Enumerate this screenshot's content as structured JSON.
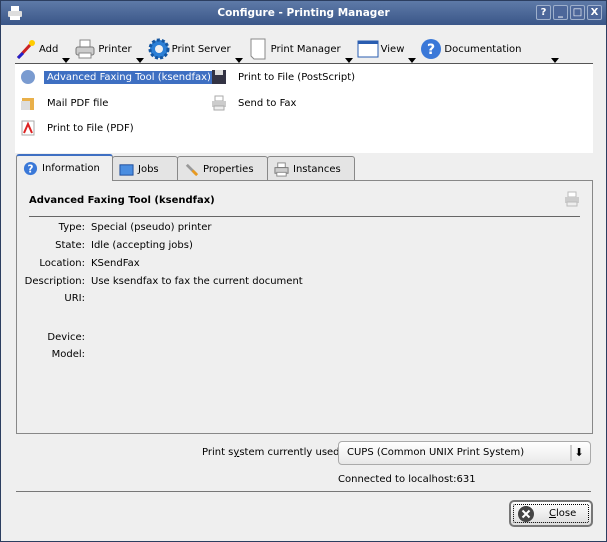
{
  "window": {
    "title": "Configure - Printing Manager",
    "buttons": [
      "?",
      "_",
      "□",
      "X"
    ]
  },
  "toolbar": [
    {
      "label": "Add",
      "icon": "wand-icon"
    },
    {
      "label": "Printer",
      "icon": "printer-icon"
    },
    {
      "label": "Print Server",
      "icon": "gear-icon"
    },
    {
      "label": "Print Manager",
      "icon": "document-icon"
    },
    {
      "label": "View",
      "icon": "window-icon"
    },
    {
      "label": "Documentation",
      "icon": "help-icon"
    }
  ],
  "printers": [
    {
      "label": "Advanced Faxing Tool (ksendfax)",
      "selected": true
    },
    {
      "label": "Print to File (PostScript)"
    },
    {
      "label": "Mail PDF file"
    },
    {
      "label": "Send to Fax"
    },
    {
      "label": "Print to File (PDF)"
    }
  ],
  "tabs": [
    {
      "label": "Information"
    },
    {
      "label": "Jobs"
    },
    {
      "label": "Properties"
    },
    {
      "label": "Instances"
    }
  ],
  "info": {
    "title": "Advanced Faxing Tool (ksendfax)",
    "rows": [
      {
        "key": "Type:",
        "value": "Special (pseudo) printer"
      },
      {
        "key": "State:",
        "value": "Idle (accepting jobs)"
      },
      {
        "key": "Location:",
        "value": "KSendFax"
      },
      {
        "key": "Description:",
        "value": "Use ksendfax to fax the current document"
      },
      {
        "key": "URI:",
        "value": ""
      },
      {
        "key": "Device:",
        "value": ""
      },
      {
        "key": "Model:",
        "value": ""
      }
    ]
  },
  "footer": {
    "label_pre": "Print s",
    "label_u": "y",
    "label_post": "stem currently used:",
    "print_system": "CUPS (Common UNIX Print System)",
    "connection": "Connected to localhost:631",
    "close_u": "C",
    "close_rest": "lose"
  }
}
